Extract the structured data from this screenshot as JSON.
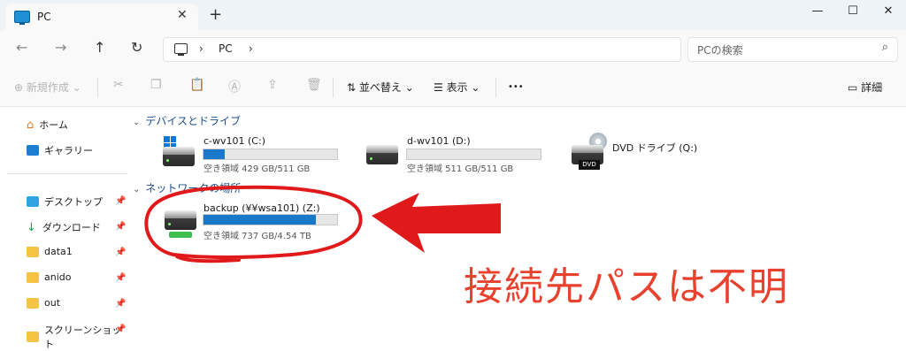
{
  "tab": {
    "title": "PC",
    "close": "✕",
    "new": "+"
  },
  "window": {
    "minimize": "—",
    "maximize": "☐",
    "close": "✕"
  },
  "nav": {
    "back": "←",
    "forward": "→",
    "up": "↑",
    "refresh": "↻"
  },
  "address": {
    "sep1": "›",
    "crumb": "PC",
    "sep2": "›"
  },
  "search": {
    "placeholder": "PCの検索",
    "icon": "⌕"
  },
  "commands": {
    "new_label": "新規作成",
    "sort_label": "並べ替え",
    "view_label": "表示",
    "more": "•••",
    "details_label": "詳細"
  },
  "sidebar": {
    "home": "ホーム",
    "gallery": "ギャラリー",
    "desktop": "デスクトップ",
    "downloads": "ダウンロード",
    "data1": "data1",
    "anido": "anido",
    "out": "out",
    "screenshot": "スクリーンショット",
    "pin": "📌"
  },
  "groups": {
    "devices": "デバイスとドライブ",
    "network": "ネットワークの場所"
  },
  "drives": [
    {
      "name": "c-wv101 (C:)",
      "free": "空き領域 429 GB/511 GB",
      "used_fraction": 0.16
    },
    {
      "name": "d-wv101 (D:)",
      "free": "空き領域 511 GB/511 GB",
      "used_fraction": 0.0
    },
    {
      "name": "DVD ドライブ (Q:)",
      "badge": "DVD"
    }
  ],
  "network_drive": {
    "name": "backup (¥¥wsa101) (Z:)",
    "free": "空き領域 737 GB/4.54 TB",
    "used_fraction": 0.84
  },
  "annotation": {
    "text": "接続先パスは不明",
    "color": "#e8412e"
  }
}
